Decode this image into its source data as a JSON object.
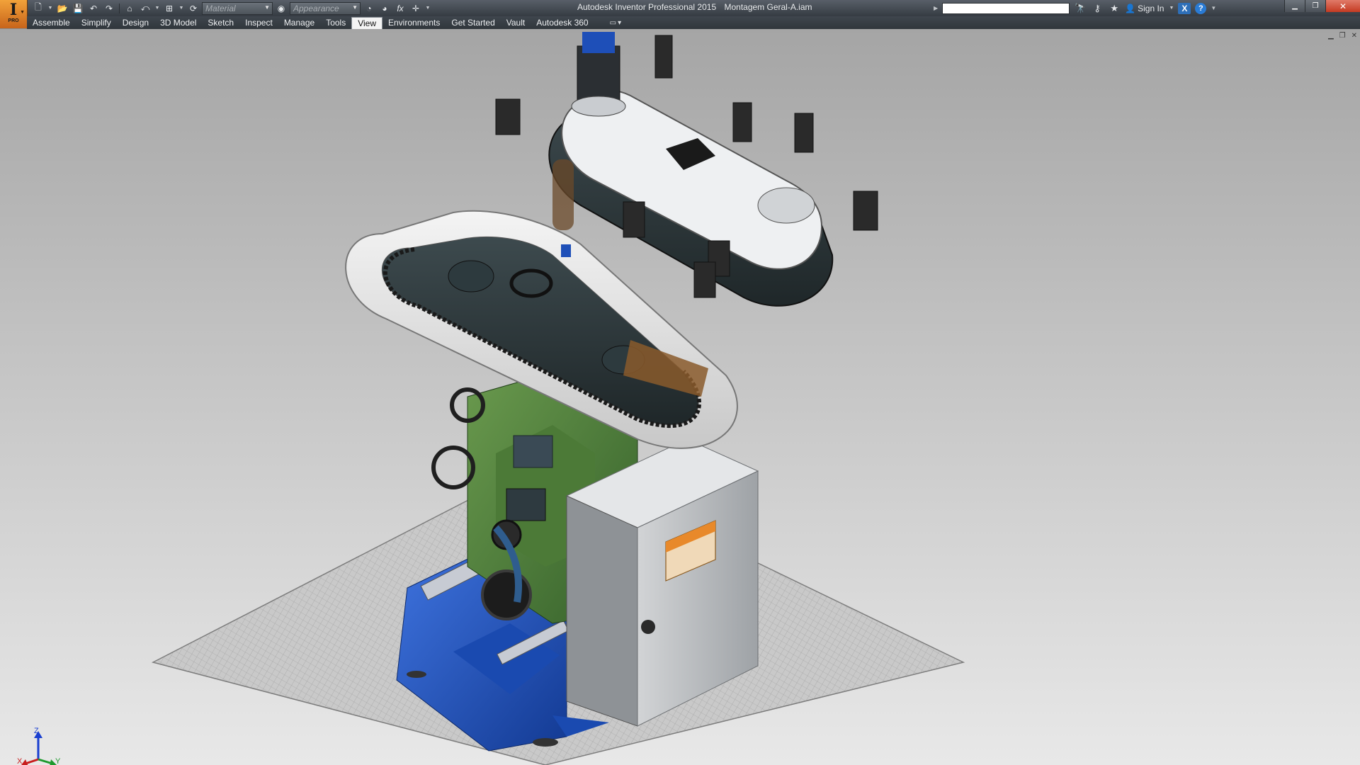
{
  "app": {
    "title": "Autodesk Inventor Professional 2015",
    "document": "Montagem Geral-A.iam",
    "logo_letter": "I",
    "edition": "PRO"
  },
  "quick_access": {
    "material_placeholder": "Material",
    "appearance_placeholder": "Appearance",
    "icons": [
      "new-icon",
      "open-icon",
      "save-icon",
      "undo-icon",
      "redo-icon",
      "home-icon",
      "return-icon",
      "select-icon",
      "update-icon",
      "material-combo",
      "appearance-combo",
      "clear-override-icon",
      "adjust-icon",
      "parameters-icon",
      "measure-icon",
      "customize-icon"
    ]
  },
  "help": {
    "search_value": "",
    "sign_in": "Sign In",
    "icons": [
      "binoculars-icon",
      "key-icon",
      "star-icon",
      "user-icon",
      "exchange-icon",
      "help-icon"
    ]
  },
  "window_controls": [
    "minimize",
    "restore",
    "close"
  ],
  "ribbon": {
    "tabs": [
      {
        "label": "Assemble",
        "active": false
      },
      {
        "label": "Simplify",
        "active": false
      },
      {
        "label": "Design",
        "active": false
      },
      {
        "label": "3D Model",
        "active": false
      },
      {
        "label": "Sketch",
        "active": false
      },
      {
        "label": "Inspect",
        "active": false
      },
      {
        "label": "Manage",
        "active": false
      },
      {
        "label": "Tools",
        "active": false
      },
      {
        "label": "View",
        "active": true
      },
      {
        "label": "Environments",
        "active": false
      },
      {
        "label": "Get Started",
        "active": false
      },
      {
        "label": "Vault",
        "active": false
      },
      {
        "label": "Autodesk 360",
        "active": false
      }
    ]
  },
  "viewport": {
    "triad": {
      "z": "Z",
      "x": "X",
      "y": "Y"
    }
  },
  "colors": {
    "accent_orange": "#e8892a",
    "machine_green": "#4f7f3a",
    "base_blue": "#1e4fb8",
    "cabinet_grey": "#b9bcbf",
    "dark_body": "#2b3437"
  }
}
